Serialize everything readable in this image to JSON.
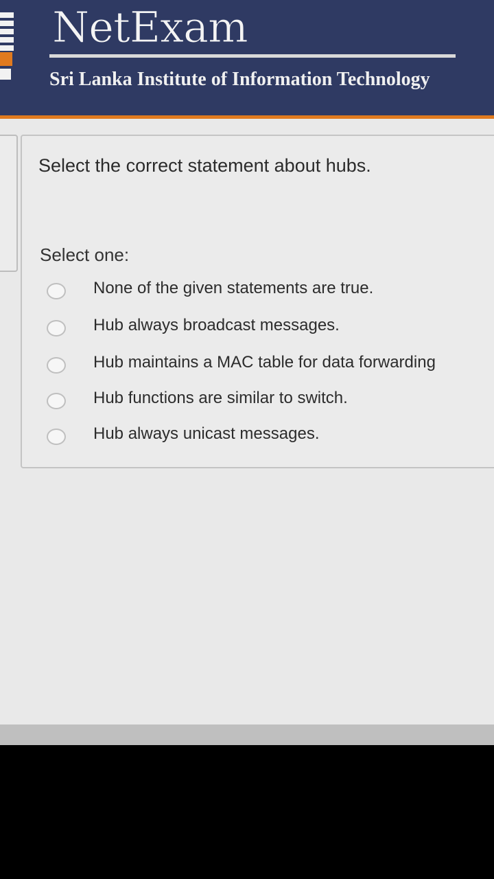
{
  "header": {
    "app_title": "NetExam",
    "institution": "Sri Lanka Institute of Information Technology"
  },
  "question": {
    "text": "Select the correct statement about hubs.",
    "prompt": "Select one:",
    "options": [
      {
        "label": "None of the given statements are true."
      },
      {
        "label": "Hub always broadcast messages."
      },
      {
        "label": "Hub maintains a MAC table for data forwarding"
      },
      {
        "label": "Hub functions are similar to switch."
      },
      {
        "label": "Hub always unicast messages."
      }
    ]
  },
  "colors": {
    "header_bg": "#2f3a63",
    "accent": "#e07a1f",
    "page_bg": "#e9e9e9"
  }
}
